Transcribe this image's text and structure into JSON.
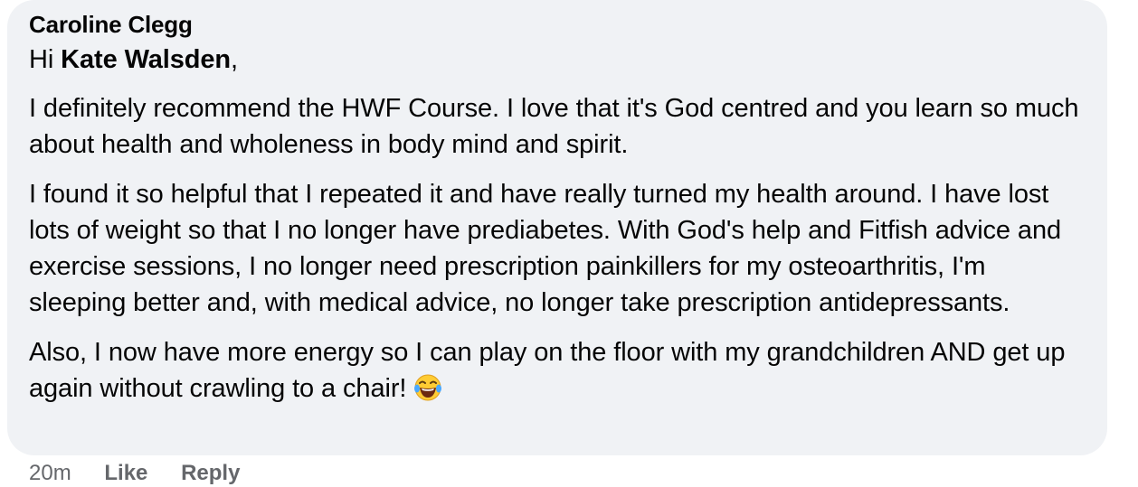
{
  "comment": {
    "author": "Caroline Clegg",
    "greeting_prefix": "Hi ",
    "mention": "Kate Walsden",
    "greeting_suffix": ",",
    "paragraph_1": "I definitely recommend the HWF Course. I love that it's God centred and you learn so much about health and wholeness in body mind and spirit.",
    "paragraph_2": "I found it so helpful that I repeated it and have really turned my health around. I have lost lots of weight so that I no longer have prediabetes. With God's help and Fitfish advice and exercise sessions, I no longer need prescription painkillers for my osteoarthritis, I'm sleeping better and, with medical advice, no longer take prescription antidepressants.",
    "paragraph_3": "Also, I now have more energy so I can play on the floor with my grandchildren AND get up again without crawling to a chair!",
    "emoji": "face-with-tears-of-joy-icon"
  },
  "actions": {
    "timestamp": "20m",
    "like_label": "Like",
    "reply_label": "Reply"
  },
  "colors": {
    "bubble_background": "#f0f2f5",
    "text": "#050505",
    "secondary_text": "#65676b"
  }
}
